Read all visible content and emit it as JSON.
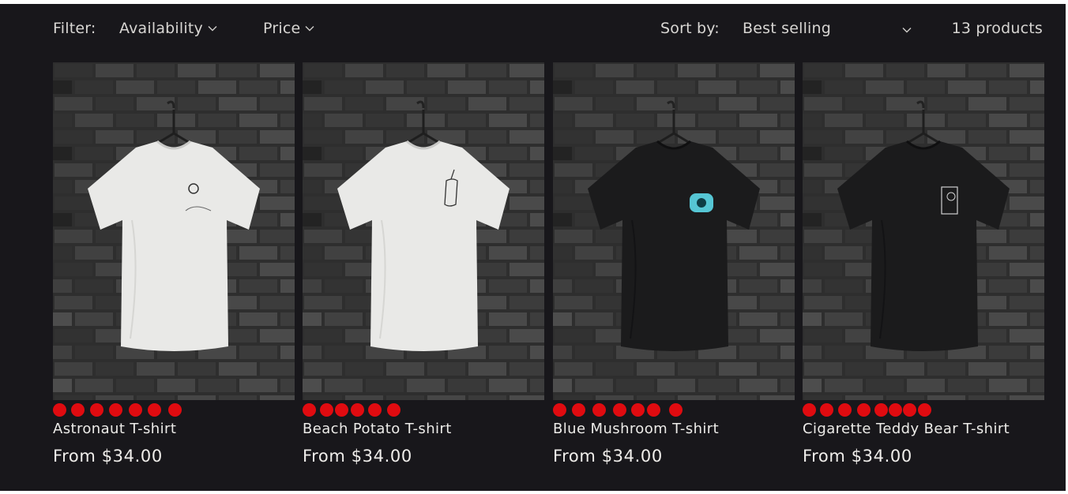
{
  "filter": {
    "label": "Filter:",
    "availability": "Availability",
    "price": "Price"
  },
  "sort": {
    "label": "Sort by:",
    "value": "Best selling"
  },
  "product_count": "13 products",
  "colors": {
    "background": "#18171b",
    "swatch": "#e00b10",
    "text": "#e8e6e3"
  },
  "products": [
    {
      "title": "Astronaut T-shirt",
      "price": "From $34.00",
      "shirt_color": "white",
      "swatch_count": 7
    },
    {
      "title": "Beach Potato T-shirt",
      "price": "From $34.00",
      "shirt_color": "white",
      "swatch_count": 6
    },
    {
      "title": "Blue Mushroom T-shirt",
      "price": "From $34.00",
      "shirt_color": "black",
      "swatch_count": 7
    },
    {
      "title": "Cigarette Teddy Bear T-shirt",
      "price": "From $34.00",
      "shirt_color": "black",
      "swatch_count": 8
    }
  ]
}
